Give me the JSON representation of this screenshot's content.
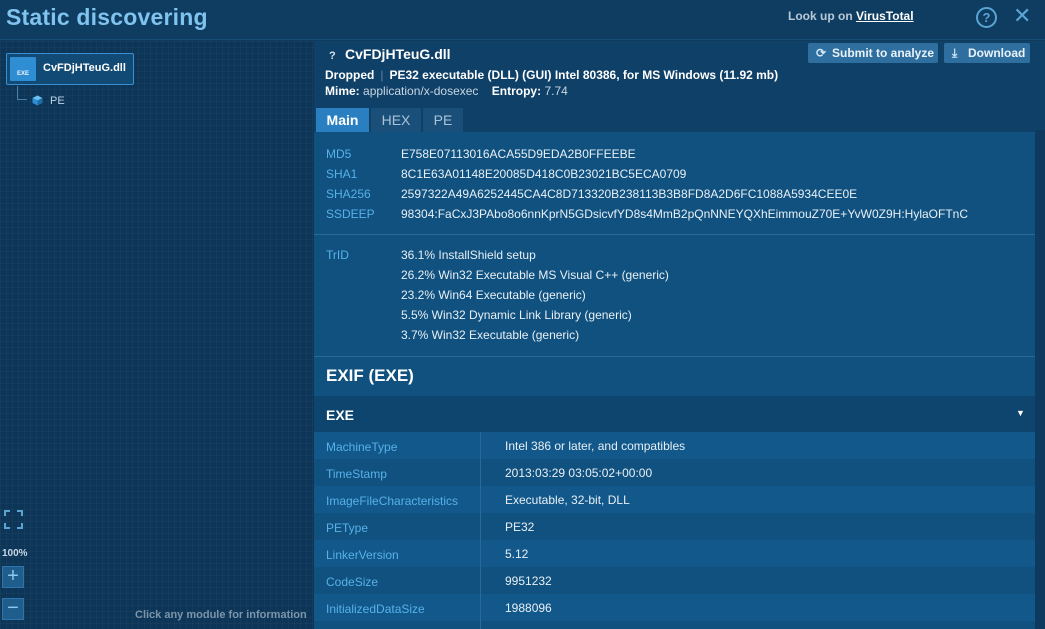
{
  "header": {
    "title": "Static discovering",
    "lookup_prefix": "Look up on",
    "lookup_brand": "VirusTotal",
    "help_glyph": "?",
    "close_glyph": "✕"
  },
  "tree": {
    "root_label": "CvFDjHTeuG.dll",
    "root_icon_text": "EXE",
    "child_label": "PE",
    "zoom": "100%",
    "zoom_in": "+",
    "zoom_out": "−",
    "hint": "Click any module for information"
  },
  "file": {
    "unknown_mark": "?",
    "name": "CvFDjHTeuG.dll",
    "submit_label": "Submit to analyze",
    "download_label": "Download",
    "status": "Dropped",
    "type_info": "PE32 executable (DLL) (GUI) Intel 80386, for MS Windows (11.92 mb)",
    "mime_label": "Mime:",
    "mime_value": "application/x-dosexec",
    "entropy_label": "Entropy:",
    "entropy_value": "7.74"
  },
  "tabs": [
    {
      "label": "Main",
      "active": true
    },
    {
      "label": "HEX",
      "active": false
    },
    {
      "label": "PE",
      "active": false
    }
  ],
  "hashes": [
    {
      "key": "MD5",
      "value": "E758E07113016ACA55D9EDA2B0FFEEBE"
    },
    {
      "key": "SHA1",
      "value": "8C1E63A01148E20085D418C0B23021BC5ECA0709"
    },
    {
      "key": "SHA256",
      "value": "2597322A49A6252445CA4C8D713320B238113B3B8FD8A2D6FC1088A5934CEE0E"
    },
    {
      "key": "SSDEEP",
      "value": "98304:FaCxJ3PAbo8o6nnKprN5GDsicvfYD8s4MmB2pQnNNEYQXhEimmouZ70E+YvW0Z9H:HylaOFTnC"
    }
  ],
  "trid": {
    "key": "TrID",
    "items": [
      "36.1% InstallShield setup",
      "26.2% Win32 Executable MS Visual C++ (generic)",
      "23.2% Win64 Executable (generic)",
      "5.5% Win32 Dynamic Link Library (generic)",
      "3.7% Win32 Executable (generic)"
    ]
  },
  "exif": {
    "title": "EXIF (EXE)",
    "section": "EXE",
    "caret": "▼",
    "rows": [
      {
        "key": "MachineType",
        "value": "Intel 386 or later, and compatibles"
      },
      {
        "key": "TimeStamp",
        "value": "2013:03:29 03:05:02+00:00"
      },
      {
        "key": "ImageFileCharacteristics",
        "value": "Executable, 32-bit, DLL"
      },
      {
        "key": "PEType",
        "value": "PE32"
      },
      {
        "key": "LinkerVersion",
        "value": "5.12"
      },
      {
        "key": "CodeSize",
        "value": "9951232"
      },
      {
        "key": "InitializedDataSize",
        "value": "1988096"
      }
    ]
  }
}
